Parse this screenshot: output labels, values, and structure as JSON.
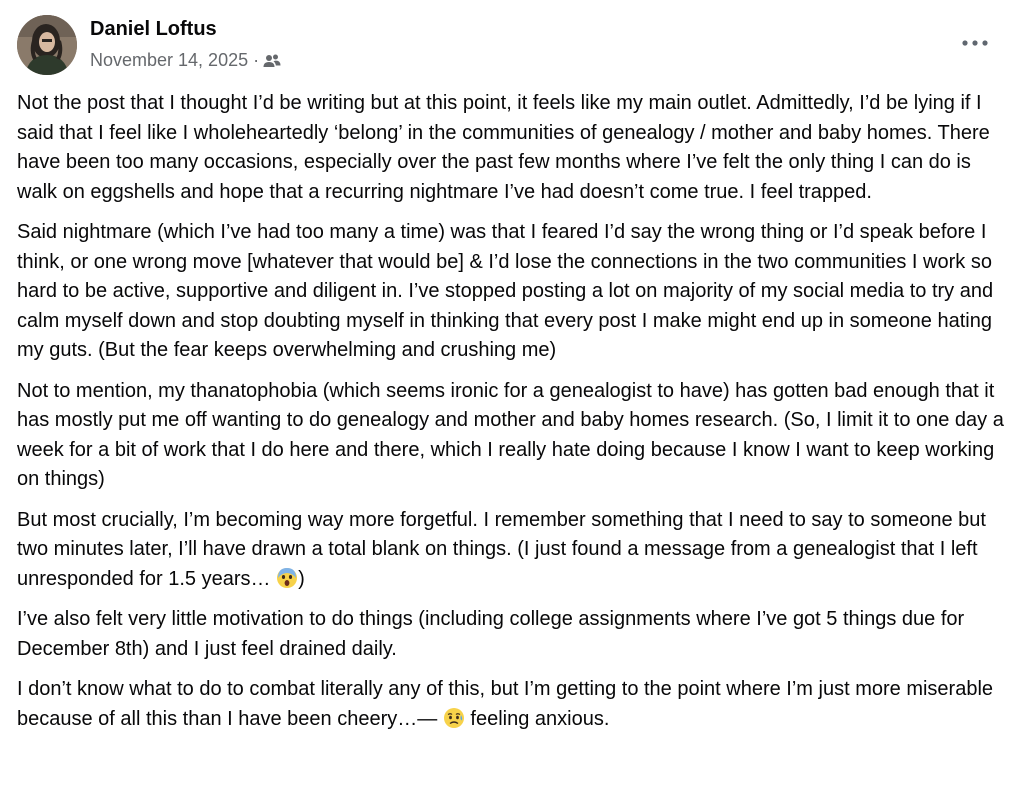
{
  "post": {
    "author": "Daniel Loftus",
    "date": "November 14, 2025",
    "separator": "·",
    "audience_icon": "friends-icon",
    "more_icon": "more-options-icon",
    "paragraphs": [
      "Not the post that I thought I’d be writing but at this point, it feels like my main outlet. Admittedly, I’d be lying if I said that I feel like I wholeheartedly ‘belong’ in the communities of genealogy / mother and baby homes. There have been too many occasions, especially over the past few months where I’ve felt the only thing I can do is walk on eggshells and hope that a recurring nightmare I’ve had doesn’t come true. I feel trapped.",
      "Said nightmare (which I’ve had too many a time) was that I feared I’d say the wrong thing or I’d speak before I think, or one wrong move [whatever that would be] & I’d lose the connections in the two communities I work so hard to be active, supportive and diligent in. I’ve stopped posting a lot on majority of my social media to try and calm myself down and stop doubting myself in thinking that every post I make might end up in someone hating my guts. (But the fear keeps overwhelming and crushing me)",
      "Not to mention, my thanatophobia (which seems ironic for a genealogist to have) has gotten bad enough that it has mostly put me off wanting to do genealogy and mother and baby homes research. (So, I limit it to one day a week for a bit of work that I do here and there, which I really hate doing because I know I want to keep working on things)",
      "But most crucially, I’m becoming way more forgetful. I remember something that I need to say to someone but two minutes later, I’ll have drawn a total blank on things. (I just found a message from a genealogist that I left unresponded for 1.5 years…",
      "I’ve also felt very little motivation to do things (including college assignments where I’ve got 5 things due for December 8th) and I just feel drained daily.",
      "I don’t know what to do to combat literally any of this, but I’m getting to the point where I’m just more miserable because of all this than I have been cheery…—"
    ],
    "p4_suffix": ")",
    "p4_emoji": "screaming-face-emoji",
    "feeling_emoji": "anxious-face-emoji",
    "feeling_text": "feeling anxious."
  }
}
